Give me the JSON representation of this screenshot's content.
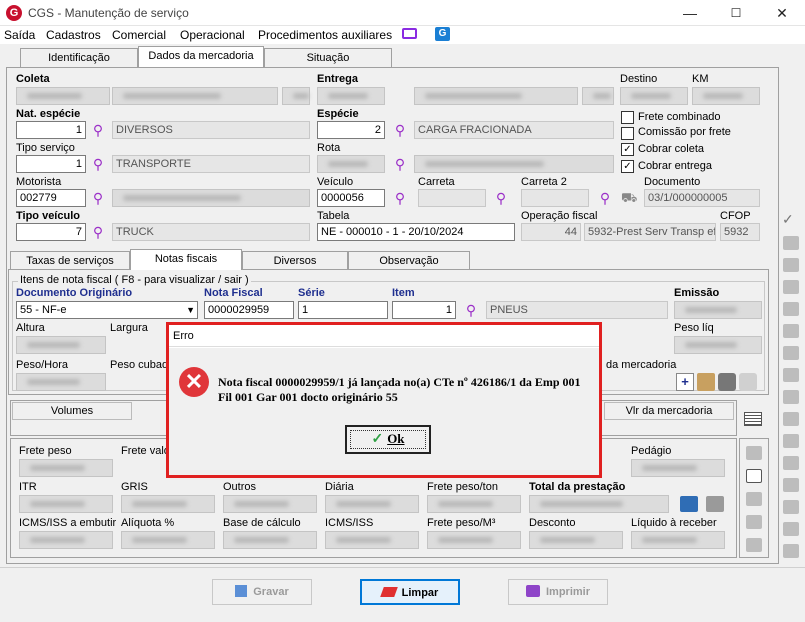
{
  "app": {
    "logo": "G",
    "title": "CGS - Manutenção de serviço"
  },
  "window": {
    "minimize": "—",
    "maximize": "☐",
    "close": "✕"
  },
  "menu": [
    "Saída",
    "Cadastros",
    "Comercial",
    "Operacional",
    "Procedimentos auxiliares"
  ],
  "top_tabs": [
    "Identificação",
    "Dados da mercadoria",
    "Situação"
  ],
  "form": {
    "coleta": "Coleta",
    "entrega": "Entrega",
    "destino": "Destino",
    "km": "KM",
    "nat_especie": "Nat. espécie",
    "nat_especie_code": "1",
    "nat_especie_desc": "DIVERSOS",
    "especie": "Espécie",
    "especie_code": "2",
    "especie_desc": "CARGA FRACIONADA",
    "frete_combinado": "Frete combinado",
    "comissao_por_frete": "Comissão por frete",
    "cobrar_coleta": "Cobrar coleta",
    "cobrar_entrega": "Cobrar entrega",
    "tipo_servico": "Tipo serviço",
    "tipo_servico_code": "1",
    "tipo_servico_desc": "TRANSPORTE",
    "rota": "Rota",
    "motorista": "Motorista",
    "motorista_code": "002779",
    "veiculo": "Veículo",
    "veiculo_code": "0000056",
    "carreta": "Carreta",
    "carreta2": "Carreta 2",
    "documento": "Documento",
    "documento_value": "03/1/000000005",
    "tipo_veiculo": "Tipo veículo",
    "tipo_veiculo_code": "7",
    "tipo_veiculo_desc": "TRUCK",
    "tabela": "Tabela",
    "tabela_value": "NE - 000010 - 1 - 20/10/2024",
    "operacao_fiscal": "Operação fiscal",
    "operacao_code": "44",
    "operacao_desc": "5932-Prest Serv Transp efe",
    "cfop": "CFOP",
    "cfop_value": "5932"
  },
  "sub_tabs": [
    "Taxas de serviços",
    "Notas fiscais",
    "Diversos",
    "Observação"
  ],
  "notas": {
    "group_title": "Itens de nota fiscal ( F8 - para visualizar / sair )",
    "doc_originario": "Documento Originário",
    "doc_value": "55 - NF-e",
    "nota_fiscal": "Nota Fiscal",
    "nota_value": "0000029959",
    "serie": "Série",
    "serie_value": "1",
    "item": "Item",
    "item_value": "1",
    "item_desc": "PNEUS",
    "emissao": "Emissão",
    "altura": "Altura",
    "largura": "Largura",
    "peso_liq": "Peso líq",
    "peso_hora": "Peso/Hora",
    "peso_cubado": "Peso cubad",
    "da_mercadoria": "da mercadoria",
    "volumes": "Volumes",
    "vlr_mercadoria": "Vlr da mercadoria"
  },
  "totals": {
    "frete_peso": "Frete peso",
    "frete_valor": "Frete valo",
    "pedagio": "Pedágio",
    "itr": "ITR",
    "gris": "GRIS",
    "outros": "Outros",
    "diaria": "Diária",
    "frete_peso_ton": "Frete peso/ton",
    "total_prestacao": "Total da prestação",
    "icms_embutir": "ICMS/ISS a embutir",
    "aliquota": "Alíquota %",
    "base_calculo": "Base de cálculo",
    "icms_iss": "ICMS/ISS",
    "frete_peso_m3": "Frete peso/M³",
    "desconto": "Desconto",
    "liquido_receber": "Líquido à receber"
  },
  "buttons": {
    "gravar": "Gravar",
    "limpar": "Limpar",
    "imprimir": "Imprimir"
  },
  "dialog": {
    "title": "Erro",
    "message": "Nota fiscal 0000029959/1 já lançada no(a) CTe nº 426186/1 da Emp 001 Fil 001 Gar 001 docto originário 55",
    "ok": "Ok"
  },
  "colors": {
    "accent": "#0078d7",
    "error": "#e0363a",
    "highlight_border": "#e02020",
    "lookup_icon": "#9b30c8"
  }
}
